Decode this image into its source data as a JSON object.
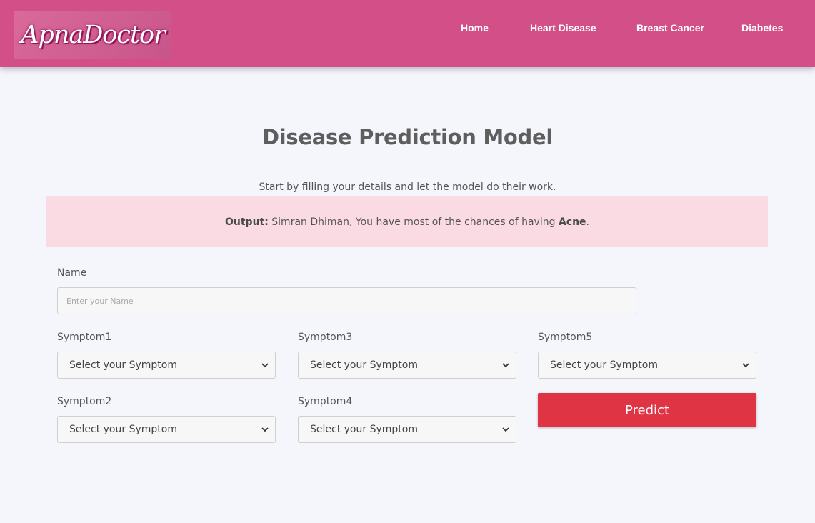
{
  "brand": {
    "logo_text": "ApnaDoctor"
  },
  "nav": {
    "home": "Home",
    "heart_disease": "Heart Disease",
    "breast_cancer": "Breast Cancer",
    "diabetes": "Diabetes"
  },
  "page": {
    "title": "Disease Prediction Model",
    "subtitle": "Start by filling your details and let the model do their work."
  },
  "output": {
    "label": "Output:",
    "message": " Simran Dhiman, You have most of the chances of having ",
    "disease": "Acne",
    "end": "."
  },
  "form": {
    "name_label": "Name",
    "name_placeholder": "Enter your Name",
    "name_value": "",
    "symptom1_label": "Symptom1",
    "symptom2_label": "Symptom2",
    "symptom3_label": "Symptom3",
    "symptom4_label": "Symptom4",
    "symptom5_label": "Symptom5",
    "select_placeholder": "Select your Symptom",
    "predict_label": "Predict"
  },
  "colors": {
    "navbar": "#d24f88",
    "output_bg": "#fadbe3",
    "predict_button": "#de3444",
    "page_bg": "#f5f6fc"
  },
  "icons": {
    "select_chevron": "chevron-down-icon"
  }
}
